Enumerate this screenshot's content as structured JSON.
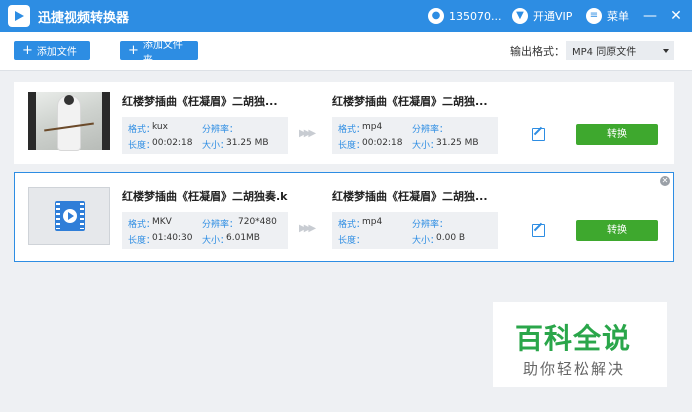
{
  "app": {
    "title": "迅捷视频转换器",
    "user": "135070...",
    "vip": "开通VIP",
    "menu": "菜单",
    "minimize": "—",
    "close": "✕"
  },
  "toolbar": {
    "add_file": "添加文件",
    "add_folder": "添加文件夹",
    "format_label": "输出格式：",
    "format_value": "MP4  同原文件"
  },
  "labels": {
    "format": "格式：",
    "resolution": "分辨率：",
    "duration": "长度：",
    "size": "大小："
  },
  "items": [
    {
      "src": {
        "name": "红楼梦插曲《枉凝眉》二胡独...",
        "format": "kux",
        "resolution": "",
        "duration": "00:02:18",
        "size": "31.25 MB"
      },
      "dst": {
        "name": "红楼梦插曲《枉凝眉》二胡独...",
        "format": "mp4",
        "resolution": "",
        "duration": "00:02:18",
        "size": "31.25 MB"
      },
      "action": "转换"
    },
    {
      "src": {
        "name": "红楼梦插曲《枉凝眉》二胡独奏.k",
        "format": "MKV",
        "resolution": "720*480",
        "duration": "01:40:30",
        "size": "6.01MB"
      },
      "dst": {
        "name": "红楼梦插曲《枉凝眉》二胡独...",
        "format": "mp4",
        "resolution": "",
        "duration": "",
        "size": "0.00 B"
      },
      "action": "转换"
    }
  ],
  "watermark": {
    "main": "百科全说",
    "sub": "助你轻松解决"
  }
}
